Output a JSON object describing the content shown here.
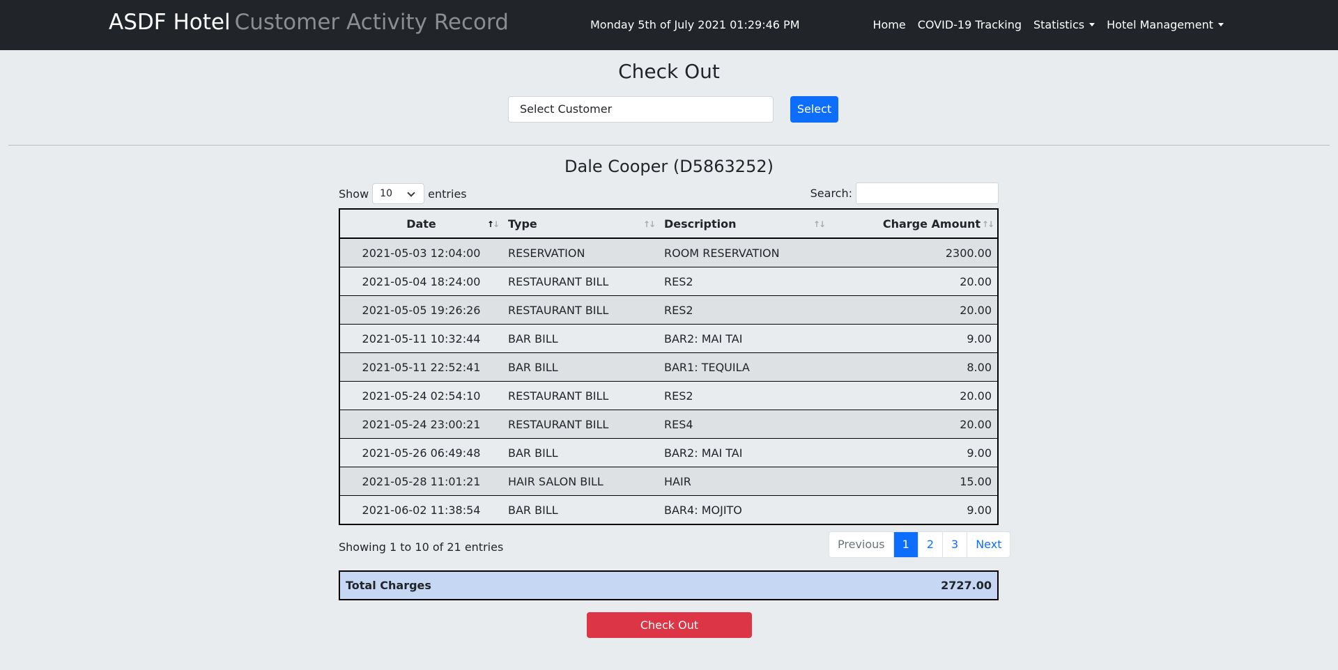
{
  "navbar": {
    "brand": "ASDF Hotel",
    "subtitle": "Customer Activity Record",
    "datetime": "Monday 5th of July 2021 01:29:46 PM",
    "links": [
      {
        "label": "Home"
      },
      {
        "label": "COVID-19 Tracking"
      },
      {
        "label": "Statistics"
      },
      {
        "label": "Hotel Management"
      }
    ]
  },
  "page": {
    "title": "Check Out",
    "customer_select_value": "Select Customer",
    "select_button": "Select",
    "customer_heading": "Dale Cooper (D5863252)"
  },
  "table_controls": {
    "show_label": "Show",
    "entries_value": "10",
    "entries_label": "entries",
    "search_label": "Search:"
  },
  "table": {
    "columns": [
      "Date",
      "Type",
      "Description",
      "Charge Amount"
    ],
    "rows": [
      [
        "2021-05-03 12:04:00",
        "RESERVATION",
        "ROOM RESERVATION",
        "2300.00"
      ],
      [
        "2021-05-04 18:24:00",
        "RESTAURANT BILL",
        "RES2",
        "20.00"
      ],
      [
        "2021-05-05 19:26:26",
        "RESTAURANT BILL",
        "RES2",
        "20.00"
      ],
      [
        "2021-05-11 10:32:44",
        "BAR BILL",
        "BAR2: MAI TAI",
        "9.00"
      ],
      [
        "2021-05-11 22:52:41",
        "BAR BILL",
        "BAR1: TEQUILA",
        "8.00"
      ],
      [
        "2021-05-24 02:54:10",
        "RESTAURANT BILL",
        "RES2",
        "20.00"
      ],
      [
        "2021-05-24 23:00:21",
        "RESTAURANT BILL",
        "RES4",
        "20.00"
      ],
      [
        "2021-05-26 06:49:48",
        "BAR BILL",
        "BAR2: MAI TAI",
        "9.00"
      ],
      [
        "2021-05-28 11:01:21",
        "HAIR SALON BILL",
        "HAIR",
        "15.00"
      ],
      [
        "2021-06-02 11:38:54",
        "BAR BILL",
        "BAR4: MOJITO",
        "9.00"
      ]
    ]
  },
  "footer": {
    "info": "Showing 1 to 10 of 21 entries",
    "pagination": [
      "Previous",
      "1",
      "2",
      "3",
      "Next"
    ],
    "total_label": "Total Charges",
    "total_value": "2727.00",
    "checkout_button": "Check Out"
  }
}
